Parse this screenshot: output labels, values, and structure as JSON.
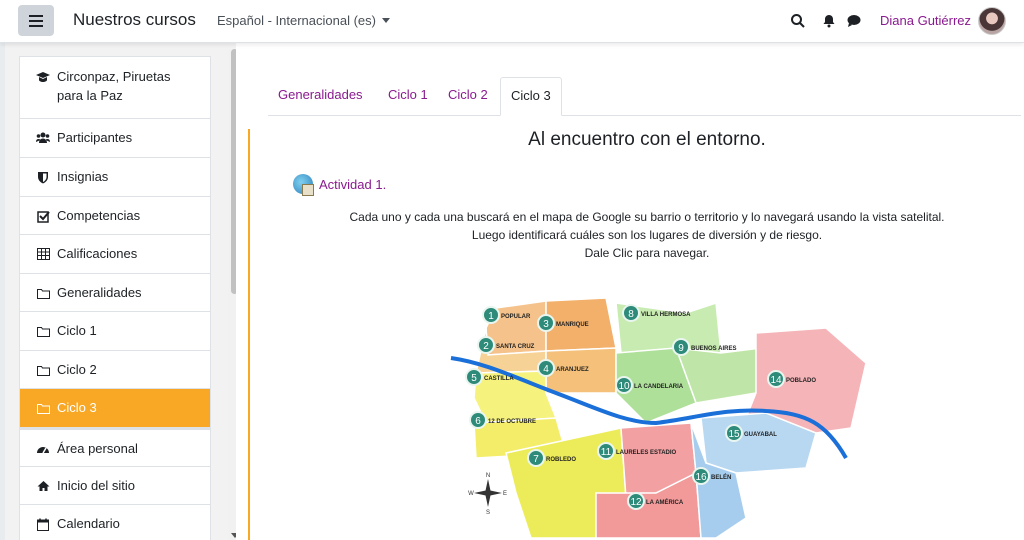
{
  "header": {
    "brand": "Nuestros cursos",
    "language": "Español - Internacional (es)",
    "user_name": "Diana Gutiérrez"
  },
  "sidebar": {
    "items": [
      {
        "label": "Circonpaz, Piruetas para la Paz",
        "icon": "graduation-cap-icon"
      },
      {
        "label": "Participantes",
        "icon": "users-icon"
      },
      {
        "label": "Insignias",
        "icon": "shield-icon"
      },
      {
        "label": "Competencias",
        "icon": "checkbox-icon"
      },
      {
        "label": "Calificaciones",
        "icon": "table-icon"
      },
      {
        "label": "Generalidades",
        "icon": "folder-icon"
      },
      {
        "label": "Ciclo 1",
        "icon": "folder-icon"
      },
      {
        "label": "Ciclo 2",
        "icon": "folder-icon"
      },
      {
        "label": "Ciclo 3",
        "icon": "folder-icon",
        "active": true
      },
      {
        "label": "Área personal",
        "icon": "dashboard-icon"
      },
      {
        "label": "Inicio del sitio",
        "icon": "home-icon"
      },
      {
        "label": "Calendario",
        "icon": "calendar-icon"
      }
    ]
  },
  "tabs": [
    "Generalidades",
    "Ciclo 1",
    "Ciclo 2",
    "Ciclo 3"
  ],
  "active_tab": "Ciclo 3",
  "section": {
    "title": "Al encuentro con el entorno.",
    "activity_label": "Actividad 1.",
    "description": [
      "Cada uno y cada una buscará en el mapa de Google su barrio o territorio y lo navegará usando la vista satelital.",
      "Luego identificará cuáles son los lugares de diversión y de riesgo.",
      "Dale Clic para navegar."
    ]
  },
  "map": {
    "districts": [
      {
        "num": "1",
        "name": "POPULAR"
      },
      {
        "num": "2",
        "name": "SANTA CRUZ"
      },
      {
        "num": "3",
        "name": "MANRIQUE"
      },
      {
        "num": "4",
        "name": "ARANJUEZ"
      },
      {
        "num": "5",
        "name": "CASTILLA"
      },
      {
        "num": "6",
        "name": "12 DE OCTUBRE"
      },
      {
        "num": "7",
        "name": "ROBLEDO"
      },
      {
        "num": "8",
        "name": "VILLA HERMOSA"
      },
      {
        "num": "9",
        "name": "BUENOS AIRES"
      },
      {
        "num": "10",
        "name": "LA CANDELARIA"
      },
      {
        "num": "11",
        "name": "LAURELES ESTADIO"
      },
      {
        "num": "12",
        "name": "LA AMÉRICA"
      },
      {
        "num": "14",
        "name": "POBLADO"
      },
      {
        "num": "15",
        "name": "GUAYABAL"
      },
      {
        "num": "16",
        "name": "BELÉN"
      }
    ],
    "compass_labels": [
      "N",
      "S",
      "E",
      "W"
    ],
    "colors": {
      "orange": "#f2b06a",
      "green": "#bfe6a8",
      "pink": "#f5b4b8",
      "yellow": "#f4f07a",
      "blue": "#b8d8f2",
      "red": "#f29a9a",
      "river": "#1a6fd8"
    }
  },
  "colors": {
    "accent": "#8a1a8f",
    "active": "#f9a825"
  }
}
